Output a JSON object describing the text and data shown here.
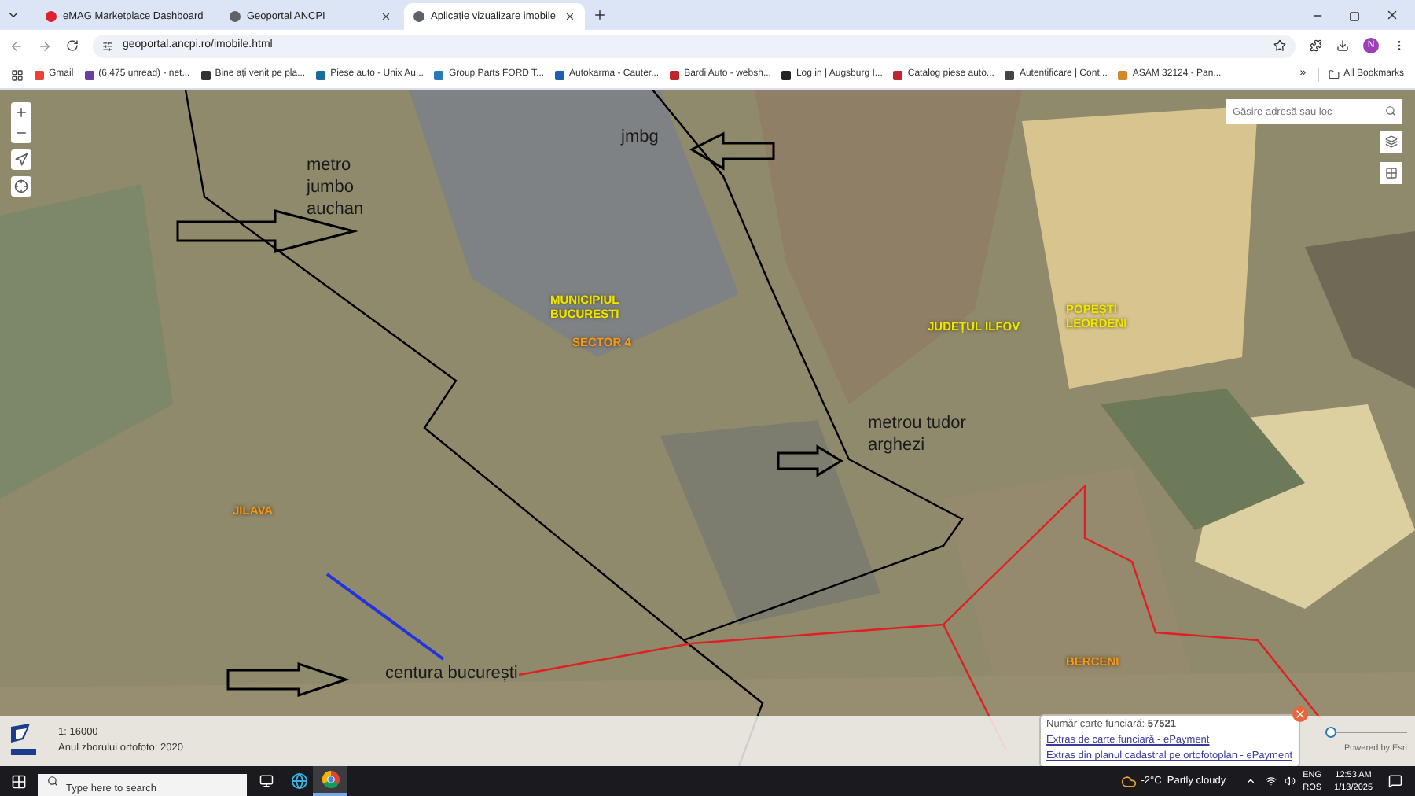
{
  "browser": {
    "tabs": [
      {
        "title": "eMAG Marketplace Dashboard",
        "selected": false
      },
      {
        "title": "Geoportal ANCPI",
        "selected": false
      },
      {
        "title": "Aplicație vizualizare imobile",
        "selected": true
      }
    ],
    "url": "geoportal.ancpi.ro/imobile.html",
    "profile": "N",
    "bookmarks": [
      {
        "label": "Gmail",
        "color": "#ea4335"
      },
      {
        "label": "(6,475 unread) - net...",
        "color": "#6b3fa0"
      },
      {
        "label": "Bine ați venit pe pla...",
        "color": "#333333"
      },
      {
        "label": "Piese auto - Unix Au...",
        "color": "#1a6b9a"
      },
      {
        "label": "Group Parts FORD T...",
        "color": "#2a7ab8"
      },
      {
        "label": "Autokarma - Cauter...",
        "color": "#1d5fa8"
      },
      {
        "label": "Bardi Auto - websh...",
        "color": "#c0262d"
      },
      {
        "label": "Log in | Augsburg I...",
        "color": "#222222"
      },
      {
        "label": "Catalog piese auto...",
        "color": "#c0262d"
      },
      {
        "label": "Autentificare | Cont...",
        "color": "#444444"
      },
      {
        "label": "ASAM 32124 - Pan...",
        "color": "#d08a2a"
      }
    ],
    "more": "»",
    "all_bookmarks": "All Bookmarks"
  },
  "map": {
    "search": {
      "placeholder": "Găsire adresă sau loc"
    },
    "labels": [
      {
        "text": "metro\njumbo\nauchan",
        "kind": "note"
      },
      {
        "text": "jmbg",
        "kind": "note"
      },
      {
        "text": "MUNICIPIUL\nBUCUREȘTI",
        "kind": "admin"
      },
      {
        "text": "SECTOR 4",
        "kind": "sector"
      },
      {
        "text": "JUDEȚUL ILFOV",
        "kind": "admin"
      },
      {
        "text": "POPEȘTI\nLEORDENI",
        "kind": "admin"
      },
      {
        "text": "metrou tudor\narghezi",
        "kind": "note"
      },
      {
        "text": "JILAVA",
        "kind": "sector"
      },
      {
        "text": "centura bucurești",
        "kind": "note"
      },
      {
        "text": "BERCENI",
        "kind": "sector"
      }
    ],
    "opacity_slider": {
      "level": 0
    },
    "scale": "1: 16000",
    "photo_year": "Anul zborului ortofoto: 2020",
    "popup": {
      "field": "Număr carte funciară: **57521**",
      "links": [
        "Extras de carte funciară - ePayment",
        "Extras din planul cadastral pe ortofotoplan - ePayment"
      ]
    },
    "attribution": "Powered by Esri"
  },
  "taskbar": {
    "search": {
      "placeholder": "Type here to search"
    },
    "weather": "-2°C  Partly cloudy",
    "lang": [
      "ENG",
      "ROS"
    ],
    "time": "12:53 AM",
    "date": "1/13/2025"
  }
}
